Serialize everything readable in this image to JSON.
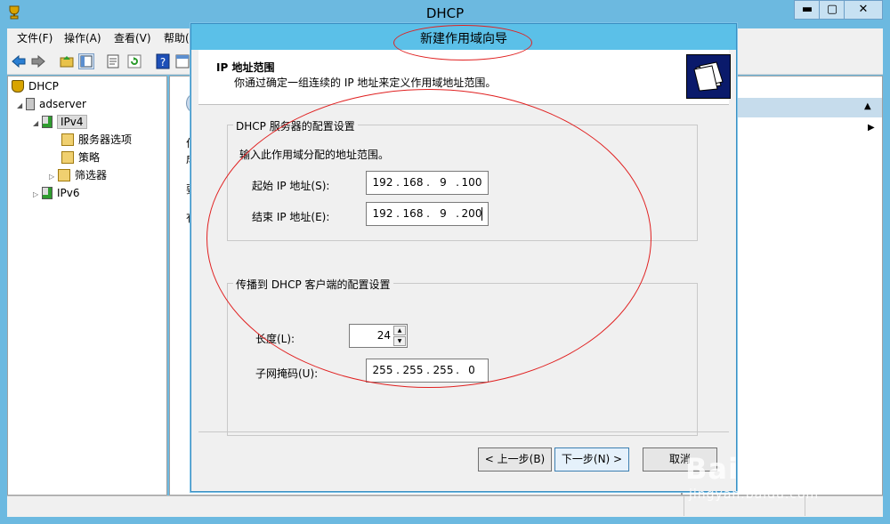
{
  "app": {
    "title": "DHCP"
  },
  "window_controls": {
    "minimize": "▬",
    "maximize": "▢",
    "close": "✕"
  },
  "menu": [
    {
      "label": "文件(F)"
    },
    {
      "label": "操作(A)"
    },
    {
      "label": "查看(V)"
    },
    {
      "label": "帮助(H)"
    }
  ],
  "tree": {
    "root": "DHCP",
    "server": "adserver",
    "ipv4": "IPv4",
    "server_options": "服务器选项",
    "policies": "策略",
    "filters": "筛选器",
    "ipv6": "IPv6"
  },
  "content_fragments": [
    "作",
    "成",
    "要",
    "有"
  ],
  "wizard": {
    "title": "新建作用域向导",
    "header_title": "IP 地址范围",
    "header_subtitle": "你通过确定一组连续的 IP 地址来定义作用域地址范围。",
    "server_group": {
      "legend": "DHCP 服务器的配置设置",
      "instruction": "输入此作用域分配的地址范围。",
      "start_label": "起始 IP 地址(S):",
      "start_ip": [
        "192",
        "168",
        "9",
        "100"
      ],
      "end_label": "结束 IP 地址(E):",
      "end_ip": [
        "192",
        "168",
        "9",
        "200"
      ]
    },
    "client_group": {
      "legend": "传播到 DHCP 客户端的配置设置",
      "length_label": "长度(L):",
      "length_value": "24",
      "mask_label": "子网掩码(U):",
      "mask": [
        "255",
        "255",
        "255",
        "0"
      ]
    },
    "buttons": {
      "back": "< 上一步(B)",
      "next": "下一步(N) >",
      "cancel": "取消"
    }
  },
  "watermark": {
    "brand": "Baidu经验",
    "url": "jingyan.baidu.com"
  },
  "colors": {
    "window_frame": "#6cb9e0",
    "wizard_title_bar": "#5bc0e8",
    "annotation": "#e02020",
    "actions_header": "#c6dcec"
  }
}
